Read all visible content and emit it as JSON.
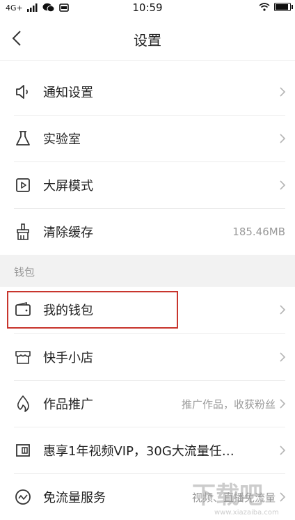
{
  "status_bar": {
    "network": "4G+",
    "time": "10:59",
    "battery_fraction": 0.9
  },
  "header": {
    "title": "设置",
    "back_icon": "chevron-left-icon"
  },
  "rows_top": [
    {
      "label": "通知设置",
      "value": "",
      "icon": "speaker-icon"
    },
    {
      "label": "实验室",
      "value": "",
      "icon": "flask-icon"
    },
    {
      "label": "大屏模式",
      "value": "",
      "icon": "play-screen-icon"
    },
    {
      "label": "清除缓存",
      "value": "185.46MB",
      "icon": "broom-icon"
    }
  ],
  "wallet_section": {
    "title": "钱包",
    "rows": [
      {
        "label": "我的钱包",
        "value": "",
        "icon": "wallet-icon"
      },
      {
        "label": "快手小店",
        "value": "",
        "icon": "store-icon"
      },
      {
        "label": "作品推广",
        "value": "推广作品，收获粉丝",
        "icon": "flame-icon"
      },
      {
        "label": "惠享1年视频VIP，30G大流量任…",
        "value": "",
        "icon": "sim-card-icon"
      },
      {
        "label": "免流量服务",
        "value": "视频、直播免流量",
        "icon": "pulse-circle-icon"
      }
    ]
  },
  "colors": {
    "highlight": "#c8352d",
    "section_bg": "#f2f2f2",
    "secondary_text": "#9a9a9a"
  },
  "watermark": {
    "text": "下载吧",
    "url_text": "www.xiazaiba.com"
  }
}
